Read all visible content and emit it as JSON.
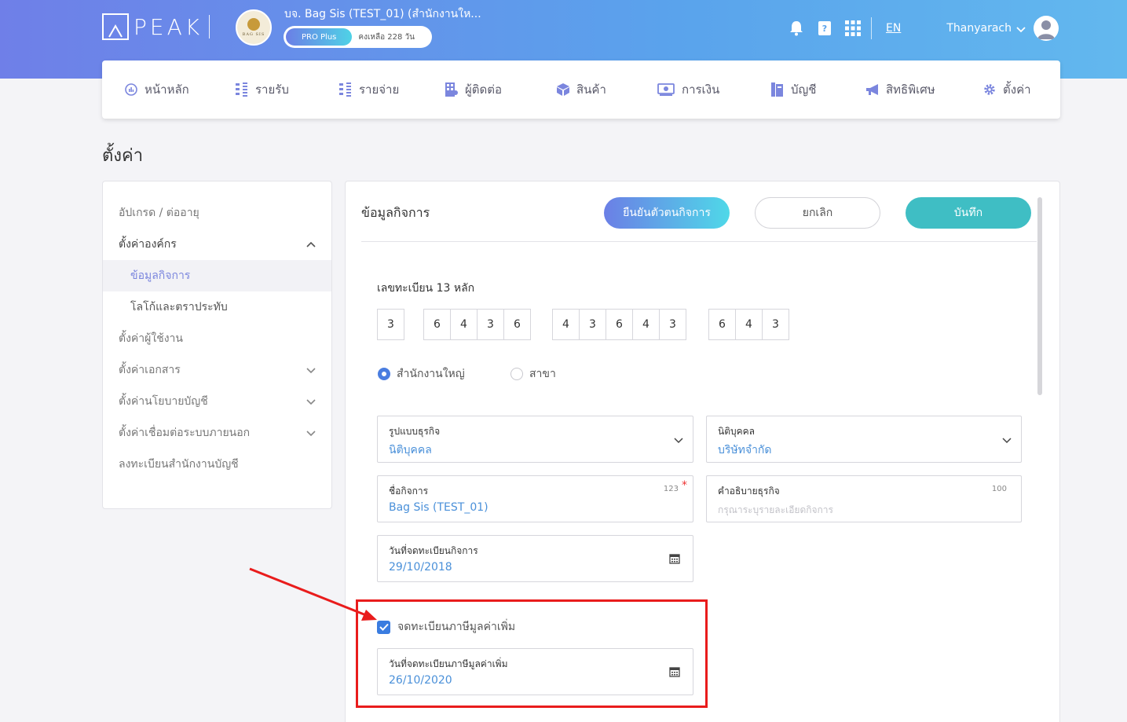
{
  "header": {
    "logo_text": "PEAK",
    "company_avatar_text": "BAG SIS",
    "company_name": "บจ. Bag Sis (TEST_01) (สำนักงานให...",
    "plan_badge": "PRO Plus",
    "plan_remaining": "คงเหลือ 228 วัน",
    "language": "EN",
    "user_name": "Thanyarach",
    "icons": [
      "bell-icon",
      "help-book-icon",
      "apps-grid-icon"
    ]
  },
  "nav": {
    "items": [
      {
        "label": "หน้าหลัก",
        "icon": "dashboard-icon"
      },
      {
        "label": "รายรับ",
        "icon": "income-icon"
      },
      {
        "label": "รายจ่าย",
        "icon": "expense-icon"
      },
      {
        "label": "ผู้ติดต่อ",
        "icon": "contacts-icon"
      },
      {
        "label": "สินค้า",
        "icon": "product-box-icon"
      },
      {
        "label": "การเงิน",
        "icon": "money-icon"
      },
      {
        "label": "บัญชี",
        "icon": "ledger-icon"
      },
      {
        "label": "สิทธิพิเศษ",
        "icon": "megaphone-icon"
      },
      {
        "label": "ตั้งค่า",
        "icon": "gear-icon"
      }
    ]
  },
  "page": {
    "title": "ตั้งค่า"
  },
  "sidebar": {
    "items": [
      {
        "label": "อัปเกรด / ต่ออายุ"
      },
      {
        "label": "ตั้งค่าองค์กร"
      },
      {
        "label": "ข้อมูลกิจการ"
      },
      {
        "label": "โลโก้และตราประทับ"
      },
      {
        "label": "ตั้งค่าผู้ใช้งาน"
      },
      {
        "label": "ตั้งค่าเอกสาร"
      },
      {
        "label": "ตั้งค่านโยบายบัญชี"
      },
      {
        "label": "ตั้งค่าเชื่อมต่อระบบภายนอก"
      },
      {
        "label": "ลงทะเบียนสำนักงานบัญชี"
      }
    ]
  },
  "form": {
    "title": "ข้อมูลกิจการ",
    "verify_label": "ยืนยันตัวตนกิจการ",
    "cancel_label": "ยกเลิก",
    "save_label": "บันทึก",
    "tax_id_label": "เลขทะเบียน 13 หลัก",
    "tax_id_digits": [
      "3",
      "6",
      "4",
      "3",
      "6",
      "4",
      "3",
      "6",
      "4",
      "3",
      "6",
      "4",
      "3"
    ],
    "radio_head_office": "สำนักงานใหญ่",
    "radio_branch": "สาขา",
    "business_type": {
      "label": "รูปแบบธุรกิจ",
      "value": "นิติบุคคล"
    },
    "juristic_type": {
      "label": "นิติบุคคล",
      "value": "บริษัทจำกัด"
    },
    "business_name": {
      "label": "ชื่อกิจการ",
      "value": "Bag Sis (TEST_01)",
      "counter": "123",
      "required_mark": "*"
    },
    "business_description": {
      "label": "คำอธิบายธุรกิจ",
      "placeholder": "กรุณาระบุรายละเอียดกิจการ",
      "counter": "100"
    },
    "registration_date": {
      "label": "วันที่จดทะเบียนกิจการ",
      "value": "29/10/2018"
    },
    "vat_registered_label": "จดทะเบียนภาษีมูลค่าเพิ่ม",
    "vat_registered": true,
    "vat_date": {
      "label": "วันที่จดทะเบียนภาษีมูลค่าเพิ่ม",
      "value": "26/10/2020"
    }
  },
  "colors": {
    "accent": "#4a90d9",
    "save": "#3fbec4",
    "highlight": "#e91c1c"
  }
}
